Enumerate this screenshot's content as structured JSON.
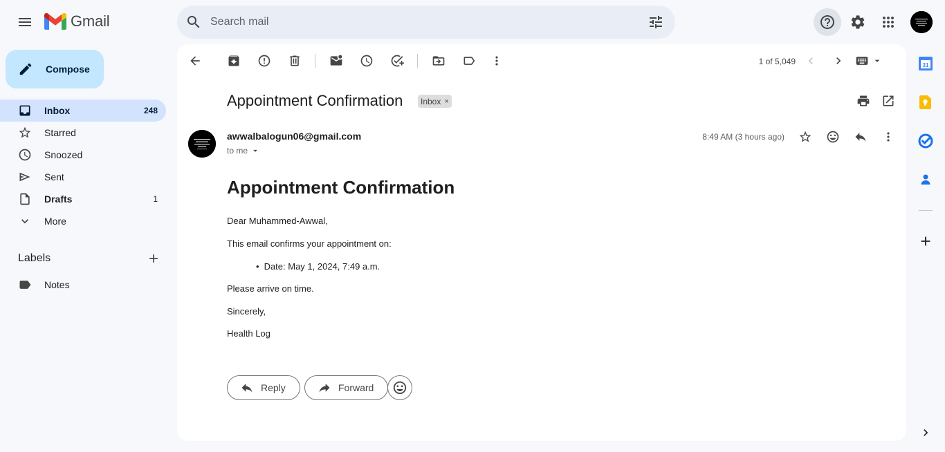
{
  "app": {
    "logo_text": "Gmail"
  },
  "search": {
    "placeholder": "Search mail"
  },
  "compose": {
    "label": "Compose"
  },
  "sidebar": {
    "items": [
      {
        "label": "Inbox",
        "count": "248"
      },
      {
        "label": "Starred",
        "count": ""
      },
      {
        "label": "Snoozed",
        "count": ""
      },
      {
        "label": "Sent",
        "count": ""
      },
      {
        "label": "Drafts",
        "count": "1"
      },
      {
        "label": "More",
        "count": ""
      }
    ],
    "labels_title": "Labels",
    "labels": [
      {
        "label": "Notes"
      }
    ]
  },
  "toolbar": {
    "count": "1 of 5,049"
  },
  "email": {
    "subject": "Appointment Confirmation",
    "badge": "Inbox",
    "badge_close": "×",
    "sender": "awwalbalogun06@gmail.com",
    "to": "to me",
    "time": "8:49 AM (3 hours ago)",
    "body": {
      "heading": "Appointment Confirmation",
      "greeting": "Dear Muhammed-Awwal,",
      "intro": "This email confirms your appointment on:",
      "bullet": "Date: May 1, 2024, 7:49 a.m.",
      "instruction": "Please arrive on time.",
      "closing": "Sincerely,",
      "signature": "Health Log"
    }
  },
  "actions": {
    "reply": "Reply",
    "forward": "Forward"
  },
  "colors": {
    "accent": "#c2e7ff",
    "active_nav": "#d3e3fd",
    "search_bg": "#e9eef6",
    "page_bg": "#f6f8fc"
  }
}
